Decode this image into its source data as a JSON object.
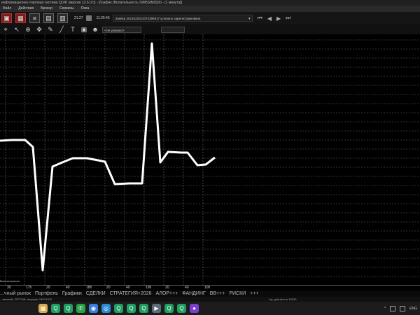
{
  "window": {
    "title": "информационно-торговая система QUIK (версия 12.6.0.0) - [График (Волатильность SIM5SIM3Q6) - [1 минута]]"
  },
  "menu": [
    "Файл",
    "Действия",
    "Брокер",
    "Сервисы",
    "Окна"
  ],
  "toolbar": {
    "clock": "21:27",
    "message_time": "11:26:45",
    "message_text": "Заявка 2021022021072296917 успешно зарегистрирована",
    "account_select": "<Не указано>",
    "buttons": [
      {
        "name": "window-button",
        "icon": "window-icon"
      },
      {
        "name": "portfolio-button",
        "icon": "chart-icon"
      },
      {
        "name": "orders-button",
        "icon": "list-icon"
      },
      {
        "name": "trades-button",
        "icon": "table-icon"
      },
      {
        "name": "news-button",
        "icon": "grid-icon"
      }
    ]
  },
  "chart_data": {
    "type": "line",
    "x_tick_labels": [
      "30",
      "17h",
      "20",
      "40",
      "18h",
      "20",
      "40",
      "19h",
      "20",
      "40",
      "10h"
    ],
    "series": [
      {
        "points": [
          [
            0,
            201
          ],
          [
            17,
            200
          ],
          [
            36,
            200
          ],
          [
            47,
            210
          ],
          [
            61,
            386
          ],
          [
            75,
            238
          ],
          [
            89,
            232
          ],
          [
            104,
            226
          ],
          [
            124,
            226
          ],
          [
            140,
            229
          ],
          [
            150,
            231
          ],
          [
            164,
            263
          ],
          [
            185,
            262
          ],
          [
            203,
            262
          ],
          [
            217,
            62
          ],
          [
            229,
            232
          ],
          [
            240,
            217
          ],
          [
            260,
            218
          ],
          [
            268,
            218
          ],
          [
            282,
            236
          ],
          [
            294,
            235
          ],
          [
            307,
            225
          ]
        ],
        "color": "#ffffff"
      }
    ],
    "grid": true,
    "bottom_label": "Волатильность"
  },
  "bottom_tabs": [
    "...чный рынок",
    "Портфель",
    "Графики",
    "СДЕЛКИ",
    "СТРАТЕГИЯ+2026",
    "АЛОР+++",
    "ФАНДИНГ",
    "ВВ+++",
    "РИСКИ",
    "+++"
  ],
  "status": {
    "left": "...записей: 2077048; текущая: 24074/1/3",
    "right": "bp_quik.alor.ru 15100"
  },
  "taskbar": {
    "apps": [
      {
        "icon": "gallery-icon",
        "color": "#d9a84a"
      },
      {
        "icon": "app-q-icon",
        "color": "#1f9e62"
      },
      {
        "icon": "app-q-icon",
        "color": "#1f9e62"
      },
      {
        "icon": "whatsapp-icon",
        "color": "#25a244"
      },
      {
        "icon": "chrome-icon",
        "color": "#3a7be0"
      },
      {
        "icon": "globe-icon",
        "color": "#2a8ad4"
      },
      {
        "icon": "app-q-icon",
        "color": "#1f9e62"
      },
      {
        "icon": "app-q-icon",
        "color": "#1f9e62"
      },
      {
        "icon": "app-q-icon",
        "color": "#1f9e62"
      },
      {
        "icon": "media-icon",
        "color": "#5e6a7a"
      },
      {
        "icon": "app-q-icon",
        "color": "#1f9e62"
      },
      {
        "icon": "app-q-icon",
        "color": "#1f9e62"
      },
      {
        "icon": "circle-icon",
        "color": "#7a3fd0"
      }
    ],
    "tray_lang": "ENG"
  }
}
